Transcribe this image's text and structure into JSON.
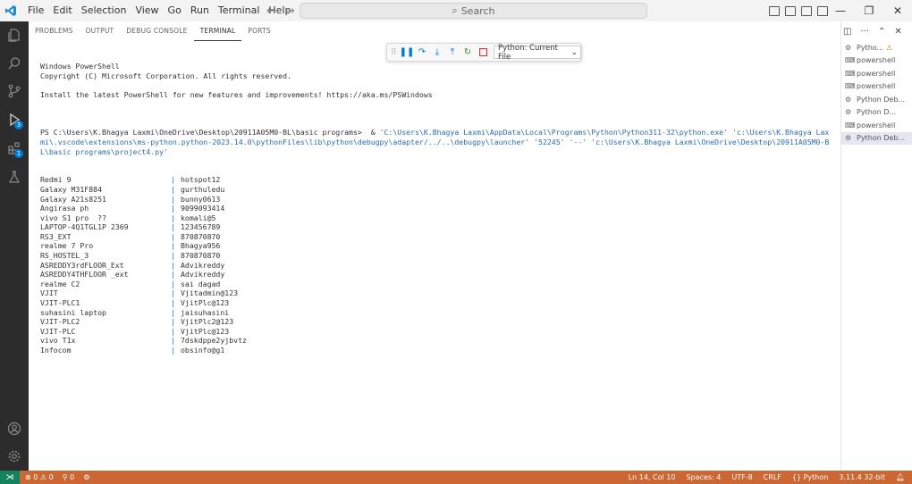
{
  "titlebar": {
    "menu": [
      "File",
      "Edit",
      "Selection",
      "View",
      "Go",
      "Run",
      "Terminal",
      "Help"
    ],
    "search_placeholder": "Search"
  },
  "panel": {
    "tabs": [
      "PROBLEMS",
      "OUTPUT",
      "DEBUG CONSOLE",
      "TERMINAL",
      "PORTS"
    ],
    "active_tab": "TERMINAL"
  },
  "debug_toolbar": {
    "config": "Python: Current File"
  },
  "terminal": {
    "header_lines": [
      "Windows PowerShell",
      "Copyright (C) Microsoft Corporation. All rights reserved.",
      "",
      "Install the latest PowerShell for new features and improvements! https://aka.ms/PSWindows",
      ""
    ],
    "prompt": "PS C:\\Users\\K.Bhagya Laxmi\\OneDrive\\Desktop\\20911A05M0-BL\\basic programs>  & ",
    "command": "'C:\\Users\\K.Bhagya Laxmi\\AppData\\Local\\Programs\\Python\\Python311-32\\python.exe' 'c:\\Users\\K.Bhagya Laxmi\\.vscode\\extensions\\ms-python.python-2023.14.0\\pythonFiles\\lib\\python\\debugpy\\adapter/../..\\debugpy\\launcher' '52245' '--' 'c:\\Users\\K.Bhagya Laxmi\\OneDrive\\Desktop\\20911A05M0-BL\\basic programs\\project4.py'",
    "rows": [
      {
        "name": "Redmi 9",
        "password": "hotspot12"
      },
      {
        "name": "Galaxy M31F884",
        "password": "gurthuledu"
      },
      {
        "name": "Galaxy A21s8251",
        "password": "bunny0613"
      },
      {
        "name": "Angirasa ph",
        "password": "9099093414"
      },
      {
        "name": "vivo S1 pro  ??",
        "password": "komali@5"
      },
      {
        "name": "LAPTOP-4Q1TGL1P 2369",
        "password": "123456789"
      },
      {
        "name": "RS3_EXT",
        "password": "870870870"
      },
      {
        "name": "realme 7 Pro",
        "password": "Bhagya956"
      },
      {
        "name": "RS_HOSTEL_3",
        "password": "870870870"
      },
      {
        "name": "ASREDDY3rdFLOOR_Ext",
        "password": "Advikreddy"
      },
      {
        "name": "ASREDDY4THFLOOR _ext",
        "password": "Advikreddy"
      },
      {
        "name": "realme C2",
        "password": "sai dagad"
      },
      {
        "name": "VJIT",
        "password": "Vjitadmin@123"
      },
      {
        "name": "VJIT-PLC1",
        "password": "VjitPlc@123"
      },
      {
        "name": "suhasini laptop",
        "password": "jaisuhasini"
      },
      {
        "name": "VJIT-PLC2",
        "password": "VjitPlc2@123"
      },
      {
        "name": "VJIT-PLC",
        "password": "VjitPlc@123"
      },
      {
        "name": "vivo T1x",
        "password": "7dskdppe2yjbvtz"
      },
      {
        "name": "Infocom",
        "password": "obsinfo@g1"
      }
    ],
    "separator": "|"
  },
  "terminal_list": [
    {
      "label": "Pytho...",
      "icon": "debug",
      "warn": true,
      "active": false
    },
    {
      "label": "powershell",
      "icon": "terminal",
      "warn": false,
      "active": false
    },
    {
      "label": "powershell",
      "icon": "terminal",
      "warn": false,
      "active": false
    },
    {
      "label": "powershell",
      "icon": "terminal",
      "warn": false,
      "active": false
    },
    {
      "label": "Python Deb...",
      "icon": "debug",
      "warn": false,
      "active": false
    },
    {
      "label": "Python D...",
      "icon": "debug",
      "warn": false,
      "active": false
    },
    {
      "label": "powershell",
      "icon": "terminal",
      "warn": false,
      "active": false
    },
    {
      "label": "Python Deb...",
      "icon": "debug",
      "warn": false,
      "active": true
    }
  ],
  "statusbar": {
    "errors": "0",
    "warnings": "0",
    "ports": "0",
    "position": "Ln 14, Col 10",
    "spaces": "Spaces: 4",
    "encoding": "UTF-8",
    "eol": "CRLF",
    "language": "Python",
    "interpreter": "3.11.4 32-bit"
  },
  "colors": {
    "statusbar": "#cc6633",
    "remote": "#16825d",
    "activitybar": "#2c2c2c",
    "accent": "#0078d4"
  }
}
